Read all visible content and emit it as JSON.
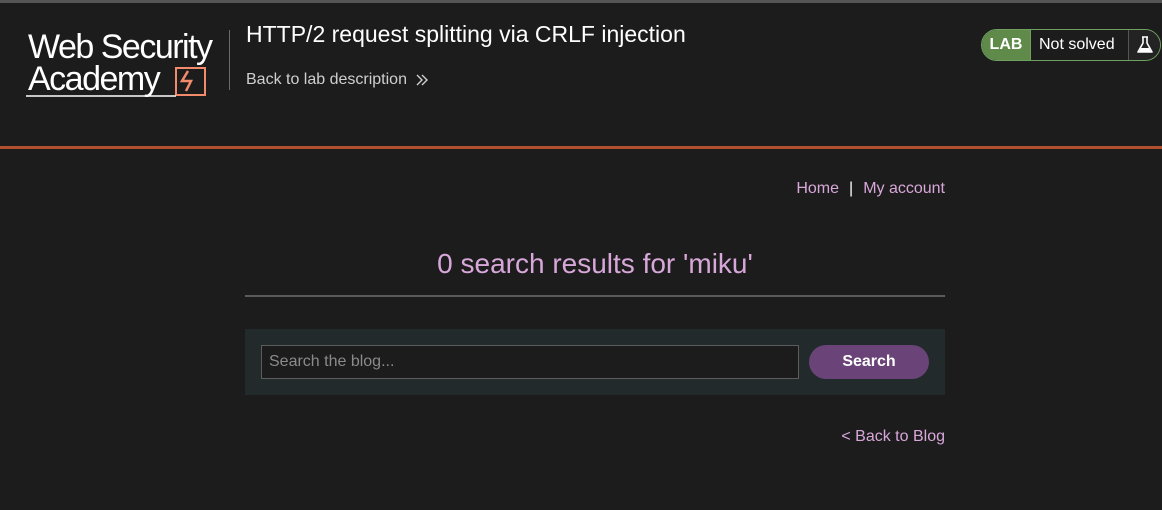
{
  "header": {
    "logo_line1": "Web Security",
    "logo_line2": "Academy",
    "lab_title": "HTTP/2 request splitting via CRLF injection",
    "back_to_description": "Back to lab description",
    "status_badge": "LAB",
    "status_text": "Not solved"
  },
  "nav": {
    "home": "Home",
    "separator": "|",
    "my_account": "My account"
  },
  "results": {
    "heading": "0 search results for 'miku'"
  },
  "search": {
    "placeholder": "Search the blog...",
    "value": "",
    "button_label": "Search"
  },
  "footer_link": {
    "back_to_blog": "< Back to Blog"
  },
  "colors": {
    "background": "#1c1c1c",
    "accent_rule": "#b0502c",
    "link_purple": "#d8a7d9",
    "button_purple": "#6a4478",
    "lab_green": "#5f8a49"
  },
  "icons": {
    "back_chevrons": "double-chevron-right-icon",
    "flask": "flask-icon",
    "logo_mark": "lightning-bolt-logo-icon"
  }
}
